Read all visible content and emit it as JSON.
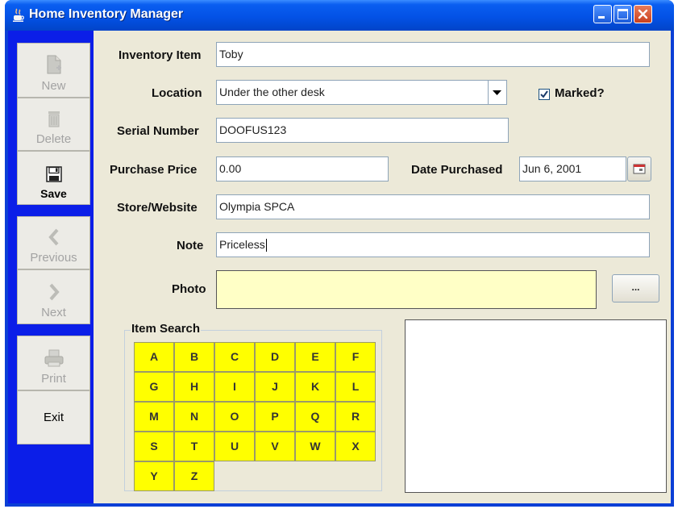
{
  "window": {
    "title": "Home Inventory Manager",
    "minimize_icon": "minimize-icon",
    "maximize_icon": "maximize-icon",
    "close_icon": "close-icon"
  },
  "sidebar": {
    "buttons": [
      {
        "label": "New",
        "icon": "new-document-icon",
        "enabled": false
      },
      {
        "label": "Delete",
        "icon": "trash-icon",
        "enabled": false
      },
      {
        "label": "Save",
        "icon": "floppy-disk-icon",
        "enabled": true
      },
      {
        "label": "Previous",
        "icon": "chevron-left-icon",
        "enabled": false
      },
      {
        "label": "Next",
        "icon": "chevron-right-icon",
        "enabled": false
      },
      {
        "label": "Print",
        "icon": "printer-icon",
        "enabled": false
      },
      {
        "label": "Exit",
        "icon": "",
        "enabled": true
      }
    ]
  },
  "form": {
    "inventory_item": {
      "label": "Inventory Item",
      "value": "Toby"
    },
    "location": {
      "label": "Location",
      "value": "Under the other desk"
    },
    "marked": {
      "label": "Marked?",
      "checked": true
    },
    "serial_number": {
      "label": "Serial Number",
      "value": "DOOFUS123"
    },
    "purchase_price": {
      "label": "Purchase Price",
      "value": "0.00"
    },
    "date_purchased": {
      "label": "Date Purchased",
      "value": "Jun 6, 2001"
    },
    "store_website": {
      "label": "Store/Website",
      "value": "Olympia SPCA"
    },
    "note": {
      "label": "Note",
      "value": "Priceless"
    },
    "photo": {
      "label": "Photo",
      "browse_label": "..."
    }
  },
  "item_search": {
    "title": "Item Search",
    "letters": [
      "A",
      "B",
      "C",
      "D",
      "E",
      "F",
      "G",
      "H",
      "I",
      "J",
      "K",
      "L",
      "M",
      "N",
      "O",
      "P",
      "Q",
      "R",
      "S",
      "T",
      "U",
      "V",
      "W",
      "X",
      "Y",
      "Z"
    ]
  },
  "colors": {
    "sidebar_bg": "#0b1ee8",
    "letter_button_bg": "#ffff00",
    "photo_field_bg": "#ffffc6",
    "titlebar": "#0352e6"
  }
}
